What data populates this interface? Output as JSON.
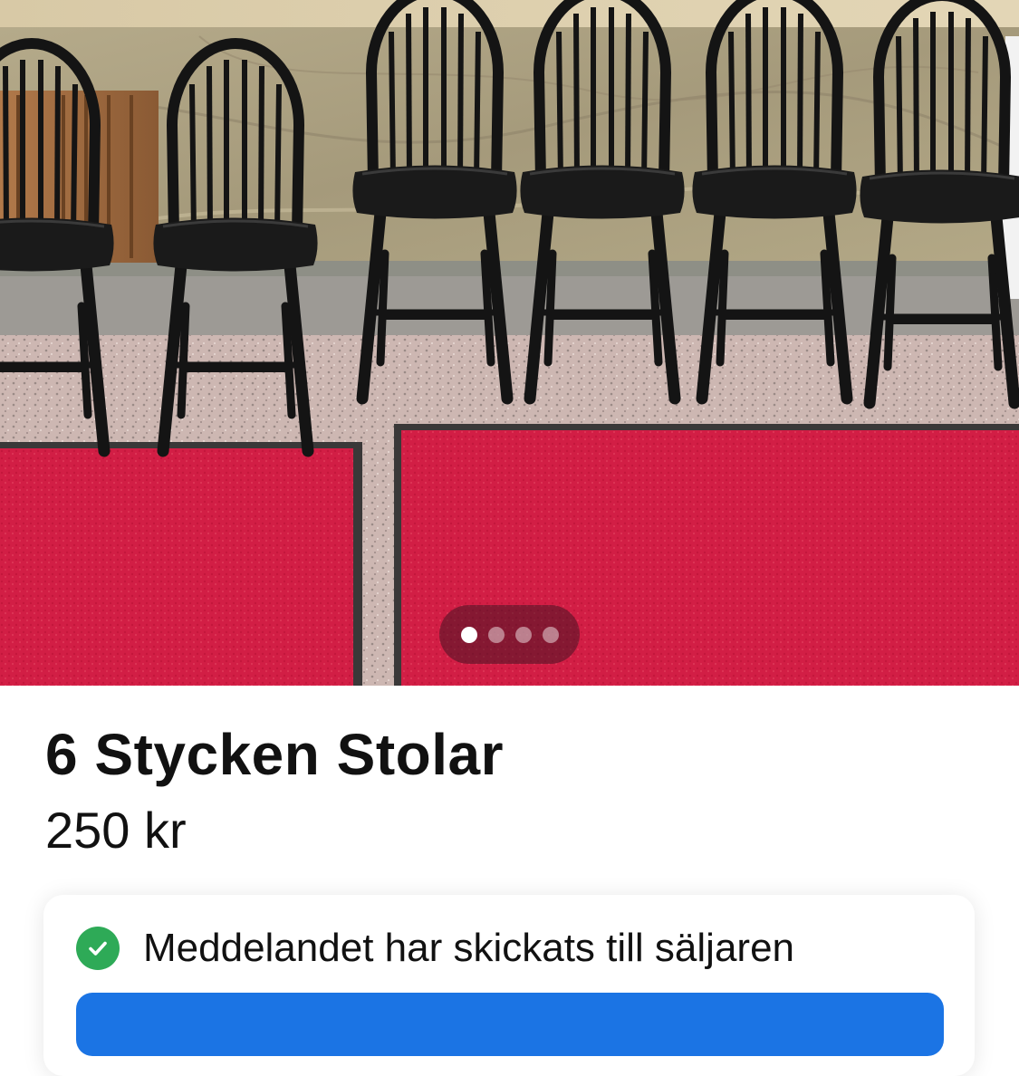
{
  "listing": {
    "title": "6 Stycken Stolar",
    "price": "250 kr"
  },
  "gallery": {
    "photo_subject": "six black spindle-back chairs on red carpet",
    "page_count": 4,
    "active_index": 0
  },
  "message_card": {
    "status_text": "Meddelandet har skickats till säljaren",
    "status_icon": "check-circle-icon",
    "button_label": ""
  },
  "colors": {
    "accent": "#1b74e4",
    "success": "#2eaa57",
    "carpet": "#d21e45",
    "chair": "#141414"
  }
}
